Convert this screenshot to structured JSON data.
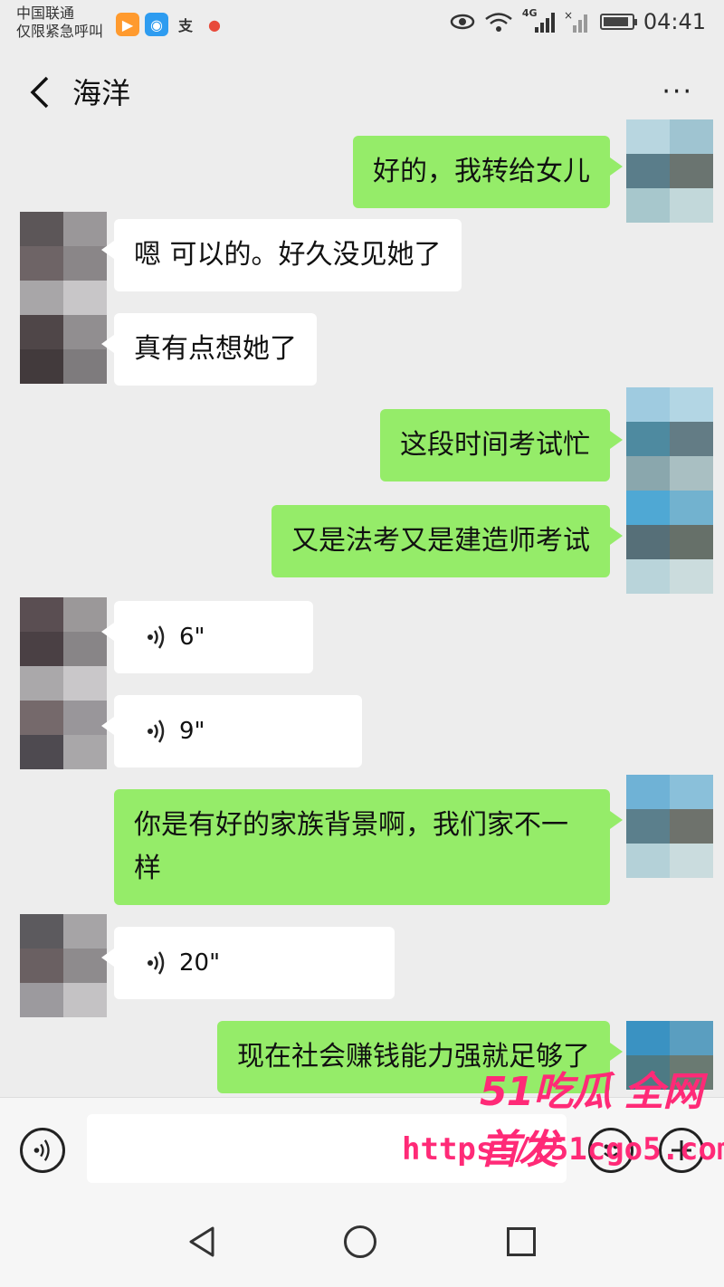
{
  "status": {
    "carrier_line1": "中国联通",
    "carrier_line2": "仅限紧急呼叫",
    "network": "4G",
    "time": "04:41",
    "app_icons": [
      "video-app-icon",
      "paw-app-icon",
      "pay-app-icon",
      "map-pin-icon"
    ],
    "battery_level": 0.9
  },
  "header": {
    "title": "海洋",
    "more": "···"
  },
  "messages": [
    {
      "side": "me",
      "type": "text",
      "text": "好的，我转给女儿"
    },
    {
      "side": "other",
      "type": "text",
      "text": "嗯 可以的。好久没见她了"
    },
    {
      "side": "other",
      "type": "text",
      "text": "真有点想她了"
    },
    {
      "side": "me",
      "type": "text",
      "text": "这段时间考试忙"
    },
    {
      "side": "me",
      "type": "text",
      "text": "又是法考又是建造师考试"
    },
    {
      "side": "other",
      "type": "voice",
      "text": "6\""
    },
    {
      "side": "other",
      "type": "voice",
      "text": "9\""
    },
    {
      "side": "me",
      "type": "text",
      "text": "你是有好的家族背景啊，我们家不一样"
    },
    {
      "side": "other",
      "type": "voice",
      "text": "20\""
    },
    {
      "side": "me",
      "type": "text",
      "text": "现在社会赚钱能力强就足够了"
    }
  ],
  "input": {
    "voice_icon": "voice-toggle-icon",
    "emoji_icon": "emoji-icon",
    "plus_icon": "plus-icon"
  },
  "watermark": {
    "line1": "51吃瓜 全网首发",
    "line2": "https://51cgo5.com"
  },
  "colors": {
    "me_bubble": "#95ec69",
    "other_bubble": "#ffffff",
    "background": "#ededed",
    "watermark": "#ff2a77"
  }
}
